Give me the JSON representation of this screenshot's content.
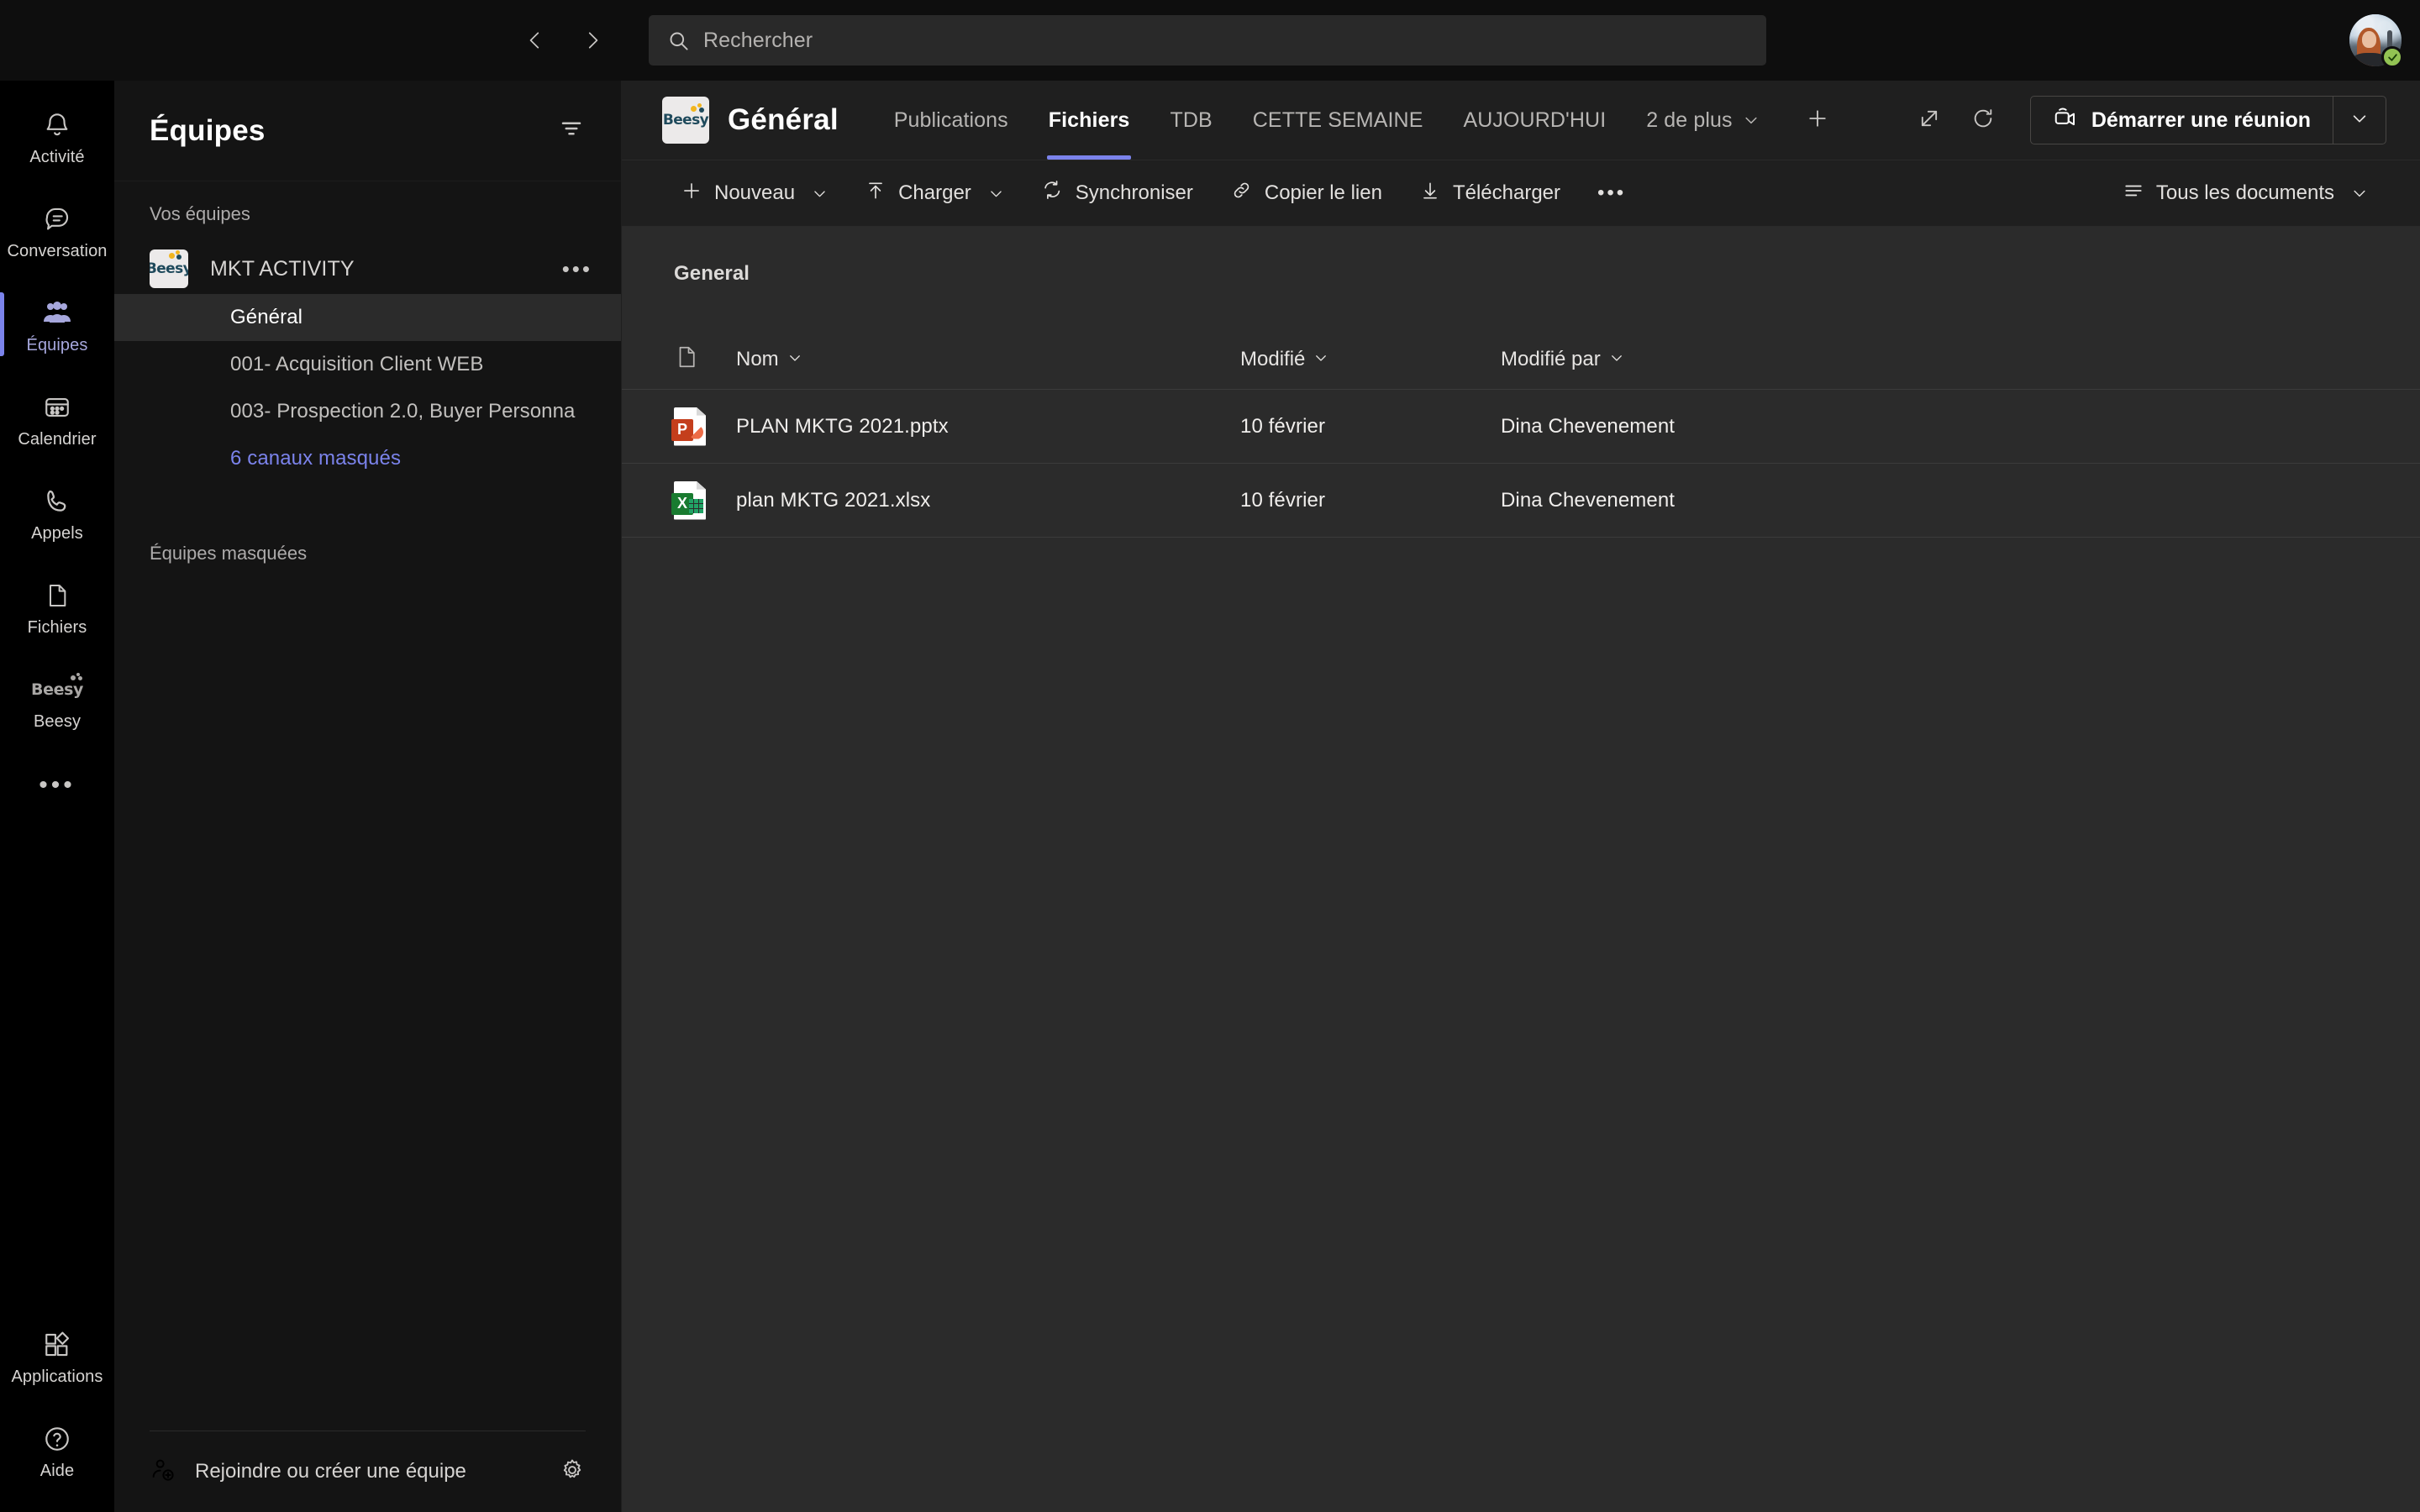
{
  "topbar": {
    "back_tooltip": "Précédent",
    "forward_tooltip": "Suivant",
    "search": {
      "placeholder": "Rechercher",
      "value": ""
    },
    "avatar_name": "Dina Chevenement",
    "presence": "Disponible"
  },
  "rail": {
    "items": [
      {
        "label": "Activité",
        "icon": "bell-icon",
        "active": false
      },
      {
        "label": "Conversation",
        "icon": "chat-icon",
        "active": false
      },
      {
        "label": "Équipes",
        "icon": "teams-icon",
        "active": true
      },
      {
        "label": "Calendrier",
        "icon": "calendar-icon",
        "active": false
      },
      {
        "label": "Appels",
        "icon": "phone-icon",
        "active": false
      },
      {
        "label": "Fichiers",
        "icon": "file-icon",
        "active": false
      },
      {
        "label": "Beesy",
        "icon": "beesy-app-icon",
        "active": false
      }
    ],
    "more_label": "•••",
    "bottom": [
      {
        "label": "Applications",
        "icon": "apps-icon"
      },
      {
        "label": "Aide",
        "icon": "help-icon"
      }
    ]
  },
  "teams_panel": {
    "title": "Équipes",
    "filter_icon": "filter-icon",
    "your_teams_label": "Vos équipes",
    "hidden_teams_label": "Équipes masquées",
    "team": {
      "name": "MKT ACTIVITY",
      "logo_text": "Beesy",
      "more_label": "•••"
    },
    "channels": [
      {
        "label": "Général",
        "selected": true,
        "link": false
      },
      {
        "label": "001- Acquisition Client WEB",
        "selected": false,
        "link": false
      },
      {
        "label": "003- Prospection 2.0, Buyer Personna",
        "selected": false,
        "link": false
      },
      {
        "label": "6 canaux masqués",
        "selected": false,
        "link": true
      }
    ],
    "footer": {
      "join_label": "Rejoindre ou créer une équipe",
      "join_icon": "add-people-icon",
      "settings_icon": "gear-icon"
    }
  },
  "channel_header": {
    "logo_text": "Beesy",
    "title": "Général",
    "tabs": [
      {
        "label": "Publications",
        "active": false,
        "caret": false
      },
      {
        "label": "Fichiers",
        "active": true,
        "caret": false
      },
      {
        "label": "TDB",
        "active": false,
        "caret": false
      },
      {
        "label": "CETTE SEMAINE",
        "active": false,
        "caret": false
      },
      {
        "label": "AUJOURD'HUI",
        "active": false,
        "caret": false
      },
      {
        "label": "2 de plus",
        "active": false,
        "caret": true
      }
    ],
    "add_tab_icon": "plus-icon",
    "popout_icon": "open-in-new-icon",
    "refresh_icon": "refresh-icon",
    "meeting_button": {
      "label": "Démarrer une réunion",
      "icon": "video-camera-icon",
      "caret_icon": "chevron-down-icon"
    }
  },
  "command_bar": {
    "commands": [
      {
        "label": "Nouveau",
        "icon": "plus-icon",
        "caret": true
      },
      {
        "label": "Charger",
        "icon": "upload-icon",
        "caret": true
      },
      {
        "label": "Synchroniser",
        "icon": "sync-icon",
        "caret": false
      },
      {
        "label": "Copier le lien",
        "icon": "link-icon",
        "caret": false
      },
      {
        "label": "Télécharger",
        "icon": "download-icon",
        "caret": false
      },
      {
        "label": "•••",
        "icon": "more-icon",
        "caret": false
      }
    ],
    "view": {
      "label": "Tous les documents",
      "icon": "list-icon",
      "caret_icon": "chevron-down-icon"
    }
  },
  "files": {
    "breadcrumb": "General",
    "columns": {
      "icon": "document-icon",
      "name": "Nom",
      "modified": "Modifié",
      "modified_by": "Modifié par"
    },
    "rows": [
      {
        "type": "pptx",
        "badge": "P",
        "name": "PLAN MKTG 2021.pptx",
        "modified": "10 février",
        "modified_by": "Dina Chevenement"
      },
      {
        "type": "xlsx",
        "badge": "X",
        "name": "plan MKTG 2021.xlsx",
        "modified": "10 février",
        "modified_by": "Dina Chevenement"
      }
    ]
  },
  "colors": {
    "accent": "#7b83eb",
    "rail_bg": "#000000",
    "panel_bg": "#141414",
    "main_bg": "#1f1f1f",
    "file_bg": "#2b2b2b",
    "presence_green": "#92c353",
    "pptx_orange": "#c43e1c",
    "xlsx_green": "#197b30"
  }
}
